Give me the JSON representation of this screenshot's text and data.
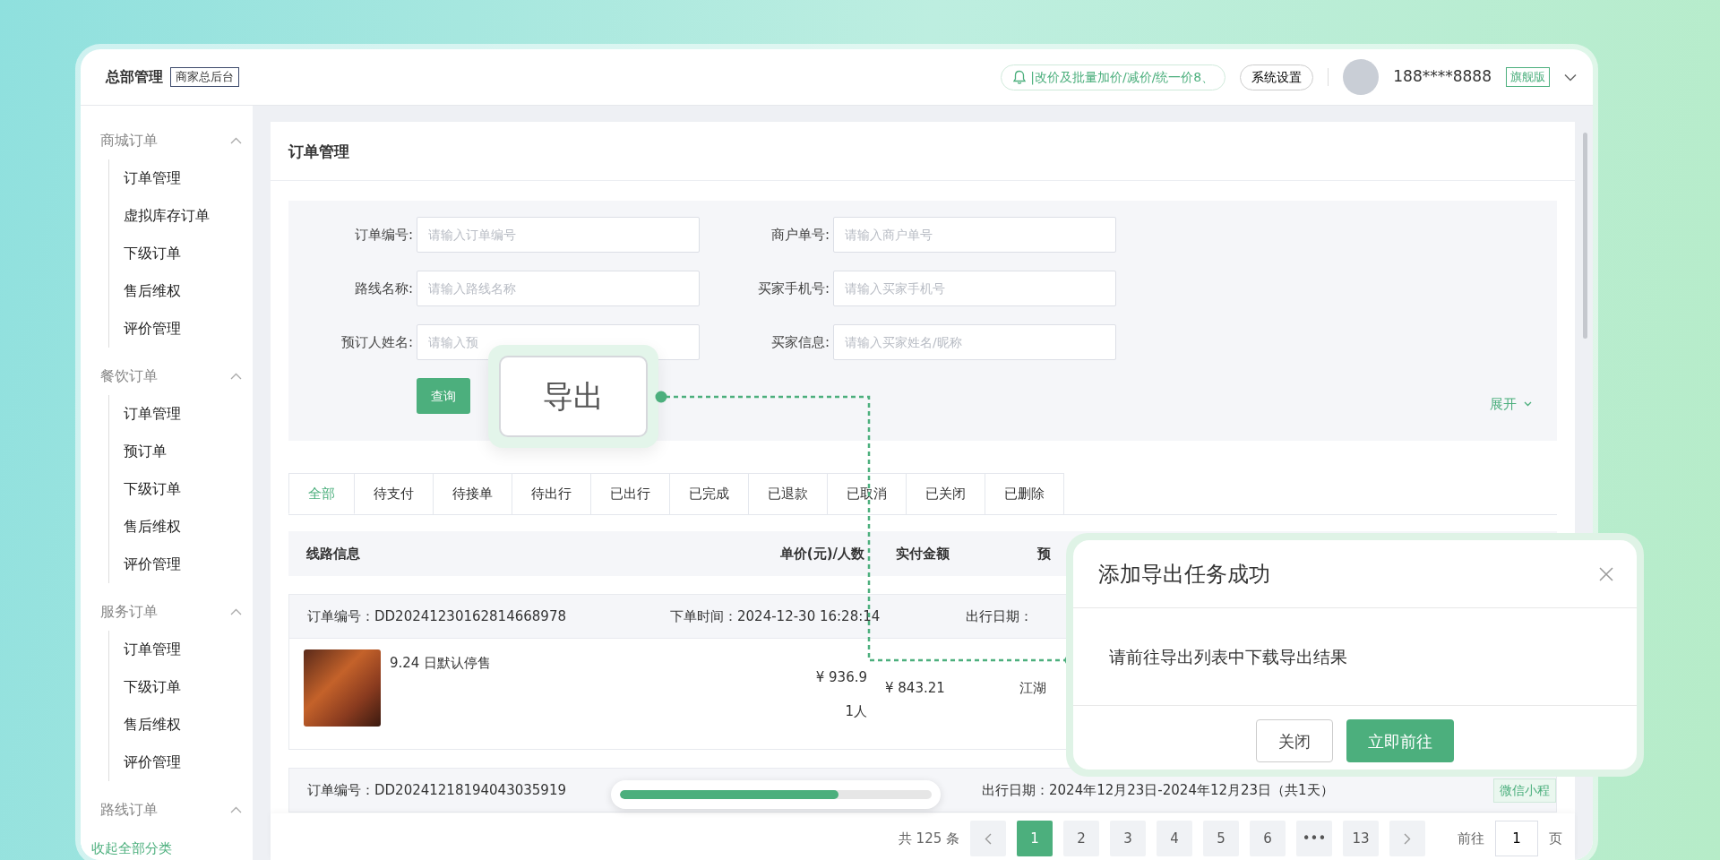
{
  "header": {
    "title": "总部管理",
    "tag": "商家总后台",
    "notice": "|改价及批量加价/减价/统一价8、",
    "settings_button": "系统设置",
    "phone": "188****8888",
    "plan_tag": "旗舰版"
  },
  "sidebar": {
    "groups": [
      {
        "title": "商城订单",
        "expanded": true,
        "items": [
          "订单管理",
          "虚拟库存订单",
          "下级订单",
          "售后维权",
          "评价管理"
        ]
      },
      {
        "title": "餐饮订单",
        "expanded": true,
        "items": [
          "订单管理",
          "预订单",
          "下级订单",
          "售后维权",
          "评价管理"
        ]
      },
      {
        "title": "服务订单",
        "expanded": true,
        "items": [
          "订单管理",
          "下级订单",
          "售后维权",
          "评价管理"
        ]
      },
      {
        "title": "路线订单",
        "expanded": true
      }
    ],
    "footer": "收起全部分类"
  },
  "page": {
    "title": "订单管理"
  },
  "filters": [
    {
      "label": "订单编号:",
      "placeholder": "请输入订单编号"
    },
    {
      "label": "商户单号:",
      "placeholder": "请输入商户单号"
    },
    {
      "label": "路线名称:",
      "placeholder": "请输入路线名称"
    },
    {
      "label": "买家手机号:",
      "placeholder": "请输入买家手机号"
    },
    {
      "label": "预订人姓名:",
      "placeholder": "请输入预"
    },
    {
      "label": "买家信息:",
      "placeholder": "请输入买家姓名/昵称"
    }
  ],
  "query_button": "查询",
  "expand_link": "展开",
  "tabs": [
    {
      "label": "全部",
      "selected": true
    },
    {
      "label": "待支付",
      "selected": false
    },
    {
      "label": "待接单",
      "selected": false
    },
    {
      "label": "待出行",
      "selected": false
    },
    {
      "label": "已出行",
      "selected": false
    },
    {
      "label": "已完成",
      "selected": false
    },
    {
      "label": "已退款",
      "selected": false
    },
    {
      "label": "已取消",
      "selected": false
    },
    {
      "label": "已关闭",
      "selected": false
    },
    {
      "label": "已删除",
      "selected": false
    }
  ],
  "table": {
    "columns": [
      "线路信息",
      "单价(元)/人数",
      "实付金额",
      "预"
    ],
    "orders": [
      {
        "order_label": "订单编号：",
        "order_no": "DD20241230162814668978",
        "time_label": "下单时间：",
        "time": "2024-12-30 16:28:14",
        "date_label": "出行日期：",
        "product": "9.24 日默认停售",
        "price": "¥ 936.9",
        "people": "1人",
        "paid": "¥ 843.21",
        "column_4": "江湖"
      },
      {
        "order_label": "订单编号：",
        "order_no": "DD20241218194043035919",
        "date_label": "出行日期：",
        "date": "2024年12月23日-2024年12月23日（共1天）",
        "channel": "微信小程"
      }
    ]
  },
  "pagination": {
    "total": "共 125 条",
    "pages": [
      {
        "label": "1",
        "selected": true
      },
      {
        "label": "2",
        "selected": false
      },
      {
        "label": "3",
        "selected": false
      },
      {
        "label": "4",
        "selected": false
      },
      {
        "label": "5",
        "selected": false
      },
      {
        "label": "6",
        "selected": false
      },
      {
        "label": "•••",
        "selected": false
      },
      {
        "label": "13",
        "selected": false
      }
    ],
    "goto_label": "前往",
    "goto_value": "1",
    "page_suffix": "页"
  },
  "export_callout": {
    "label": "导出"
  },
  "dialog": {
    "title": "添加导出任务成功",
    "message": "请前往导出列表中下载导出结果",
    "buttons": [
      {
        "label": "关闭",
        "kind": "secondary"
      },
      {
        "label": "立即前往",
        "kind": "primary"
      }
    ]
  },
  "progress": {
    "level": 0.7
  }
}
